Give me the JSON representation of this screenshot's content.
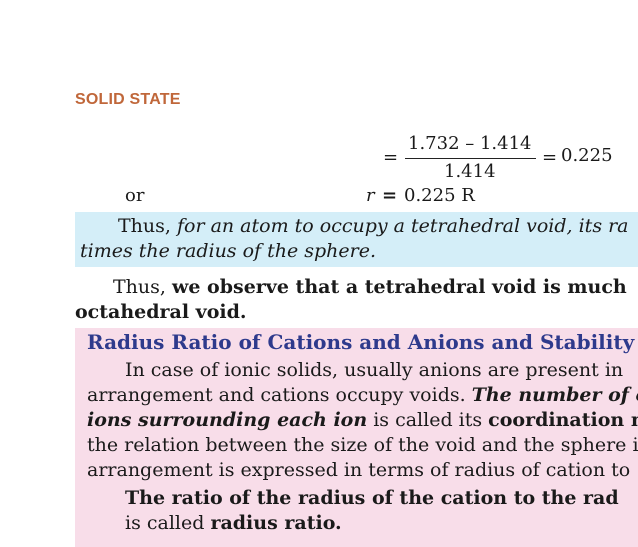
{
  "header": {
    "section_title": "SOLID STATE"
  },
  "equation": {
    "equals_1": "=",
    "numerator": "1.732 – 1.414",
    "denominator": "1.414",
    "equals_2": "=",
    "result": "0.225",
    "or_label": "or",
    "r_var": "r",
    "r_equals": "=",
    "r_value": "0.225 R"
  },
  "blue_note": {
    "lead": "Thus,",
    "line1_rest": "for an atom to occupy a tetrahedral void, its ra",
    "line2": "times the radius of the sphere."
  },
  "observation": {
    "lead": "Thus,",
    "line1_bold": "we observe that a tetrahedral void is much",
    "line2_bold": "octahedral void."
  },
  "radius_section": {
    "heading": "Radius Ratio of Cations and Anions and Stability",
    "p1_line1": "In case of ionic solids, usually anions are present in",
    "p1_line2_plain": "arrangement and cations occupy voids.",
    "p1_line2_bi": "The number of op",
    "p1_line3_bi": "ions surrounding each ion",
    "p1_line3_plain": "is called its",
    "p1_line3_bold": "coordination nu",
    "p1_line4": "the relation between the size of the void and the sphere i",
    "p1_line5": "arrangement is expressed in terms of radius of cation to",
    "def_line1": "The ratio of the radius of the cation to the rad",
    "def_line2_plain": "is called",
    "def_line2_bold": "radius ratio."
  }
}
